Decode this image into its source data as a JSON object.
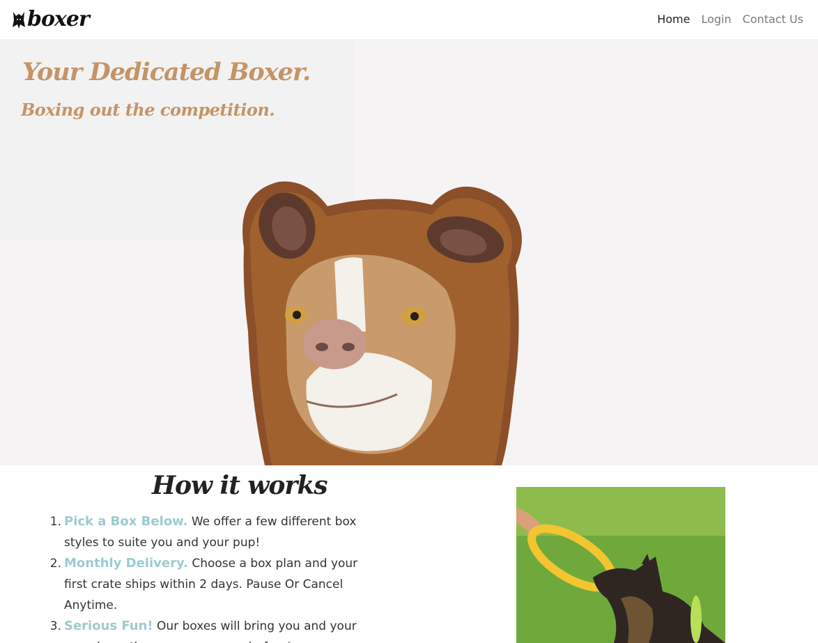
{
  "nav": {
    "brand": "boxer",
    "links": [
      "Home",
      "Login",
      "Contact Us"
    ],
    "active": "Home"
  },
  "hero": {
    "title": "Your Dedicated Boxer.",
    "subtitle": "Boxing out the competition.",
    "image": "dog-in-bear-costume"
  },
  "how_it_works": {
    "title": "How it works",
    "steps": [
      {
        "number": "1.",
        "highlight": "Pick a Box Below.",
        "text": " We offer a few different box styles to suite you and your pup!"
      },
      {
        "number": "2.",
        "highlight": "Monthly Delivery.",
        "text": " Choose a box plan and your first crate ships within 2 days. Pause Or Cancel Anytime."
      },
      {
        "number": "3.",
        "highlight": "Serious Fun!",
        "text": " Our boxes will bring you and your pup closer than you ever were before!"
      }
    ],
    "image": "german-shepherd-with-ring-toy"
  },
  "colors": {
    "hero_text": "#c49468",
    "step_highlight": "#9ccbcf",
    "hero_bg": "#f5f3f3"
  }
}
